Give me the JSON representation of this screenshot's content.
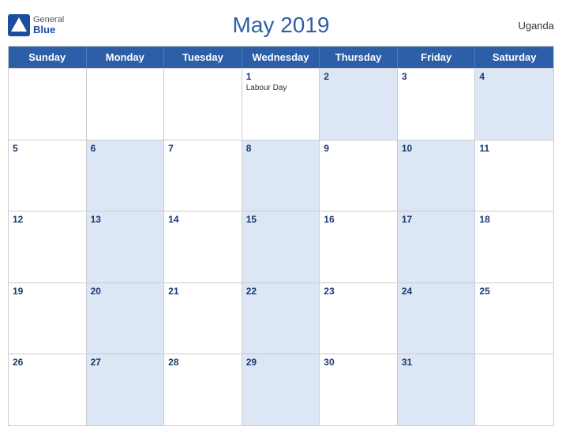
{
  "header": {
    "title": "May 2019",
    "country": "Uganda",
    "logo": {
      "general": "General",
      "blue": "Blue"
    }
  },
  "days_of_week": [
    "Sunday",
    "Monday",
    "Tuesday",
    "Wednesday",
    "Thursday",
    "Friday",
    "Saturday"
  ],
  "weeks": [
    [
      {
        "number": "",
        "shaded": false,
        "holiday": ""
      },
      {
        "number": "",
        "shaded": false,
        "holiday": ""
      },
      {
        "number": "",
        "shaded": false,
        "holiday": ""
      },
      {
        "number": "1",
        "shaded": false,
        "holiday": "Labour Day"
      },
      {
        "number": "2",
        "shaded": true,
        "holiday": ""
      },
      {
        "number": "3",
        "shaded": false,
        "holiday": ""
      },
      {
        "number": "4",
        "shaded": true,
        "holiday": ""
      }
    ],
    [
      {
        "number": "5",
        "shaded": false,
        "holiday": ""
      },
      {
        "number": "6",
        "shaded": true,
        "holiday": ""
      },
      {
        "number": "7",
        "shaded": false,
        "holiday": ""
      },
      {
        "number": "8",
        "shaded": true,
        "holiday": ""
      },
      {
        "number": "9",
        "shaded": false,
        "holiday": ""
      },
      {
        "number": "10",
        "shaded": true,
        "holiday": ""
      },
      {
        "number": "11",
        "shaded": false,
        "holiday": ""
      }
    ],
    [
      {
        "number": "12",
        "shaded": false,
        "holiday": ""
      },
      {
        "number": "13",
        "shaded": true,
        "holiday": ""
      },
      {
        "number": "14",
        "shaded": false,
        "holiday": ""
      },
      {
        "number": "15",
        "shaded": true,
        "holiday": ""
      },
      {
        "number": "16",
        "shaded": false,
        "holiday": ""
      },
      {
        "number": "17",
        "shaded": true,
        "holiday": ""
      },
      {
        "number": "18",
        "shaded": false,
        "holiday": ""
      }
    ],
    [
      {
        "number": "19",
        "shaded": false,
        "holiday": ""
      },
      {
        "number": "20",
        "shaded": true,
        "holiday": ""
      },
      {
        "number": "21",
        "shaded": false,
        "holiday": ""
      },
      {
        "number": "22",
        "shaded": true,
        "holiday": ""
      },
      {
        "number": "23",
        "shaded": false,
        "holiday": ""
      },
      {
        "number": "24",
        "shaded": true,
        "holiday": ""
      },
      {
        "number": "25",
        "shaded": false,
        "holiday": ""
      }
    ],
    [
      {
        "number": "26",
        "shaded": false,
        "holiday": ""
      },
      {
        "number": "27",
        "shaded": true,
        "holiday": ""
      },
      {
        "number": "28",
        "shaded": false,
        "holiday": ""
      },
      {
        "number": "29",
        "shaded": true,
        "holiday": ""
      },
      {
        "number": "30",
        "shaded": false,
        "holiday": ""
      },
      {
        "number": "31",
        "shaded": true,
        "holiday": ""
      },
      {
        "number": "",
        "shaded": false,
        "holiday": ""
      }
    ]
  ]
}
